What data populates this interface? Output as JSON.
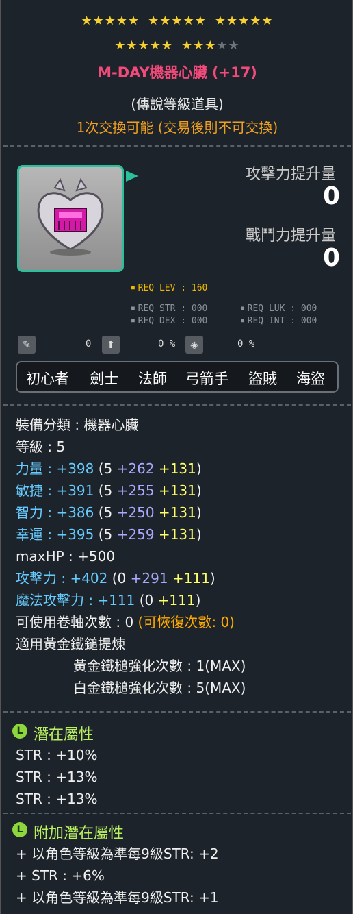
{
  "stars": {
    "row1_filled": 15,
    "row2_filled": 8,
    "row2_total": 10
  },
  "item": {
    "name": "M-DAY機器心臟 (+17)",
    "grade": "(傳說等級道具)",
    "trade": "1次交換可能 (交易後則不可交換)"
  },
  "compare": {
    "attack_label": "攻擊力提升量",
    "attack_value": "0",
    "combat_label": "戰鬥力提升量",
    "combat_value": "0"
  },
  "req": {
    "lev": "REQ LEV : 160",
    "str": "REQ STR : 000",
    "luk": "REQ LUK : 000",
    "dex": "REQ DEX : 000",
    "int": "REQ INT : 000"
  },
  "misc": {
    "v1": "0",
    "v2": "0 %",
    "v3": "0 %"
  },
  "jobs": [
    "初心者",
    "劍士",
    "法師",
    "弓箭手",
    "盜賊",
    "海盜"
  ],
  "stats": {
    "category": "裝備分類 : 機器心臟",
    "level": "等級 : 5",
    "str": {
      "label": "力量 : ",
      "total": "+398",
      "open": " (5 ",
      "base": "+262",
      "star": " +131",
      "close": ")"
    },
    "dex": {
      "label": "敏捷 : ",
      "total": "+391",
      "open": " (5 ",
      "base": "+255",
      "star": " +131",
      "close": ")"
    },
    "int": {
      "label": "智力 : ",
      "total": "+386",
      "open": " (5 ",
      "base": "+250",
      "star": " +131",
      "close": ")"
    },
    "luk": {
      "label": "幸運 : ",
      "total": "+395",
      "open": " (5 ",
      "base": "+259",
      "star": " +131",
      "close": ")"
    },
    "maxhp": "maxHP : +500",
    "att": {
      "label": "攻擊力 : ",
      "total": "+402",
      "open": " (0 ",
      "base": "+291",
      "star": " +111",
      "close": ")"
    },
    "matt": {
      "label": "魔法攻擊力 : ",
      "total": "+111",
      "open": " (0 ",
      "star": "+111",
      "close": ")"
    },
    "slots": "可使用卷軸次數 : 0",
    "slots_recover": " (可恢復次數: 0)",
    "hammer": "適用黃金鐵鎚提煉",
    "gold_hammer": "黃金鐵槌強化次數 : 1(MAX)",
    "plat_hammer": "白金鐵槌強化次數 : 5(MAX)"
  },
  "potential": {
    "badge": "L",
    "title": "潛在屬性",
    "lines": [
      "STR : +10%",
      "STR : +13%",
      "STR : +13%"
    ]
  },
  "additional": {
    "badge": "L",
    "title": "附加潛在屬性",
    "lines": [
      "+ 以角色等級為準每9級STR: +2",
      "+ STR : +6%",
      "+ 以角色等級為準每9級STR: +1"
    ]
  },
  "colors": {
    "title": "#f24a7a",
    "stat": "#66ccff",
    "base": "#aaaaff",
    "star": "#ffff66",
    "potential": "#b8f060",
    "badge": "#8ed63e"
  }
}
